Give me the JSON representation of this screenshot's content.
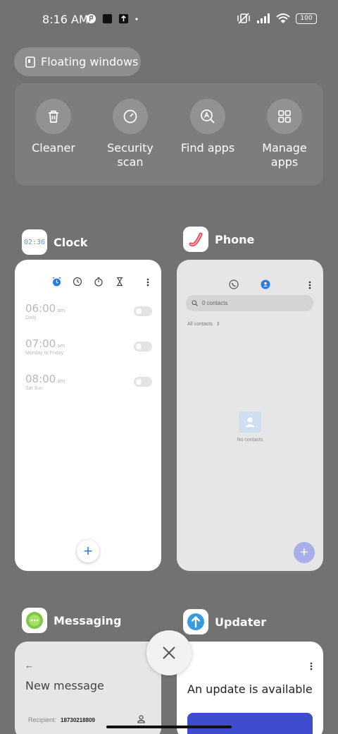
{
  "status_bar": {
    "time": "8:16 AM",
    "battery": "100"
  },
  "floating_windows": {
    "label": "Floating windows"
  },
  "quick_actions": [
    {
      "label": "Cleaner",
      "icon": "trash-icon"
    },
    {
      "label": "Security scan",
      "icon": "security-scan-icon"
    },
    {
      "label": "Find apps",
      "icon": "find-apps-icon"
    },
    {
      "label": "Manage apps",
      "icon": "grid-icon"
    }
  ],
  "apps": {
    "clock": {
      "name": "Clock",
      "icon_text": "02:36",
      "alarms": [
        {
          "time": "06:00",
          "ampm": "am",
          "repeat": "Daily"
        },
        {
          "time": "07:00",
          "ampm": "am",
          "repeat": "Monday to Friday"
        },
        {
          "time": "08:00",
          "ampm": "am",
          "repeat": "Sat Sun"
        }
      ],
      "fab": "+"
    },
    "phone": {
      "name": "Phone",
      "search_placeholder": "0 contacts",
      "filter": "All contacts",
      "empty_text": "No contacts",
      "fab": "+"
    },
    "messaging": {
      "name": "Messaging",
      "title": "New message",
      "recipient_label": "Recipient:",
      "recipient_value": "18730218809"
    },
    "updater": {
      "name": "Updater",
      "title": "An update is available"
    }
  },
  "colors": {
    "background": "#727272",
    "clock_accent": "#2c7be5",
    "phone_fab": "#a8aee8",
    "updater_banner": "#3f4ccf"
  }
}
